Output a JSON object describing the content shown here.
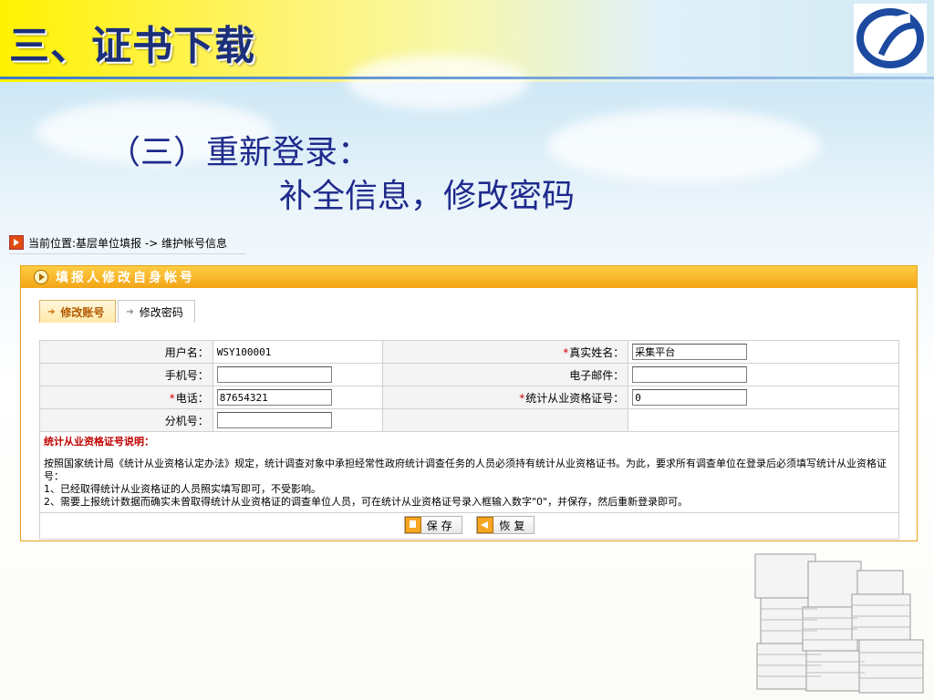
{
  "slide": {
    "title": "三、证书下载",
    "subtitle_line1": "（三）重新登录：",
    "subtitle_line2": "补全信息，修改密码"
  },
  "breadcrumb": {
    "label": "当前位置:基层单位填报 -> 维护帐号信息"
  },
  "panel": {
    "header": "填报人修改自身帐号",
    "tabs": [
      {
        "label": "修改账号",
        "active": true
      },
      {
        "label": "修改密码",
        "active": false
      }
    ]
  },
  "form": {
    "username_label": "用户名：",
    "username_value": "WSY100001",
    "realname_label": "真实姓名：",
    "realname_value": "采集平台",
    "mobile_label": "手机号：",
    "mobile_value": "",
    "email_label": "电子邮件：",
    "email_value": "",
    "phone_label": "电话：",
    "phone_value": "87654321",
    "cert_label": "统计从业资格证号：",
    "cert_value": "0",
    "ext_label": "分机号：",
    "ext_value": "",
    "required_mark": "*"
  },
  "note": {
    "title": "统计从业资格证号说明：",
    "para1": "按照国家统计局《统计从业资格认定办法》规定，统计调查对象中承担经常性政府统计调查任务的人员必须持有统计从业资格证书。为此，要求所有调查单位在登录后必须填写统计从业资格证号：",
    "item1": "1、已经取得统计从业资格证的人员照实填写即可，不受影响。",
    "item2": "2、需要上报统计数据而确实未曾取得统计从业资格证的调查单位人员，可在统计从业资格证号录入框输入数字\"0\"，并保存，然后重新登录即可。"
  },
  "buttons": {
    "save": "保存",
    "restore": "恢复"
  },
  "colors": {
    "title": "#1b2f7a",
    "panel_header": "#f2a515",
    "required": "#d00000",
    "note_title": "#c00000"
  }
}
